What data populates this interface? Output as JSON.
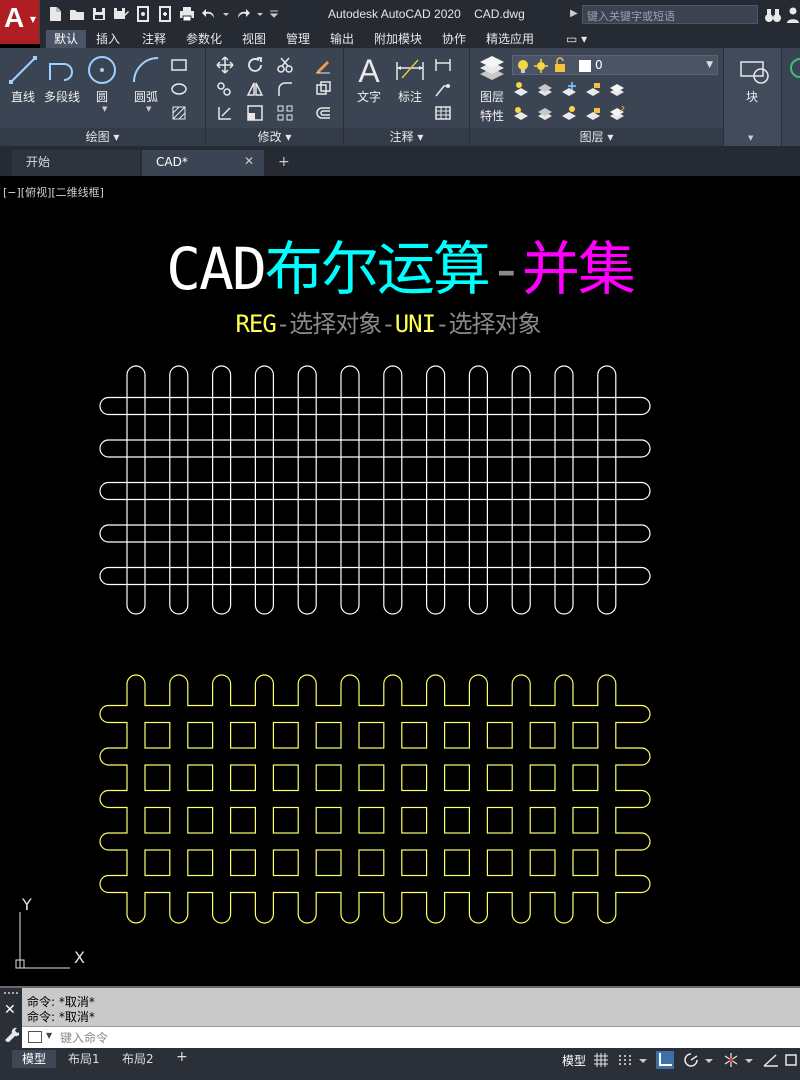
{
  "app": {
    "title": "Autodesk AutoCAD 2020    CAD.dwg",
    "logo_letter": "A",
    "search_placeholder": "键入关键字或短语"
  },
  "ribbon_tabs": [
    "默认",
    "插入",
    "注释",
    "参数化",
    "视图",
    "管理",
    "输出",
    "附加模块",
    "协作",
    "精选应用"
  ],
  "active_tab": "默认",
  "ribbon": {
    "draw_panel": {
      "label": "绘图 ▾",
      "tools": [
        "直线",
        "多段线",
        "圆",
        "圆弧"
      ]
    },
    "modify_panel": {
      "label": "修改 ▾"
    },
    "annotate_panel": {
      "label": "注释 ▾",
      "tools": [
        "文字",
        "标注"
      ]
    },
    "layer_panel": {
      "label": "图层 ▾",
      "properties_label_1": "图层",
      "properties_label_2": "特性",
      "current_layer": "0"
    },
    "block_panel": {
      "label": "块"
    }
  },
  "doc_tabs": [
    "开始",
    "CAD*"
  ],
  "active_doc_tab": "CAD*",
  "viewport_label": "[−][俯视][二维线框]",
  "canvas_text": {
    "title_parts": [
      {
        "text": "CAD",
        "color": "#ffffff"
      },
      {
        "text": "布尔运算",
        "color": "#00ffff"
      },
      {
        "text": "-",
        "color": "#8a8a8a"
      },
      {
        "text": "并集",
        "color": "#ff00ff"
      }
    ],
    "subtitle_parts": [
      {
        "text": "REG",
        "color": "#ffff55"
      },
      {
        "text": "-选择对象-",
        "color": "#8a8a8a"
      },
      {
        "text": "UNI",
        "color": "#ffff55"
      },
      {
        "text": "-选择对象",
        "color": "#8a8a8a"
      }
    ]
  },
  "drawing": {
    "vertical_slot_count": 12,
    "horizontal_slot_count": 5,
    "grid_before_color": "#ffffff",
    "grid_union_color": "#ffff66"
  },
  "ucs": {
    "x_label": "X",
    "y_label": "Y"
  },
  "command_history": [
    "命令: *取消*",
    "命令: *取消*"
  ],
  "command_input_placeholder": "键入命令",
  "layout_tabs": [
    "模型",
    "布局1",
    "布局2"
  ],
  "active_layout": "模型",
  "status": {
    "model_label": "模型"
  }
}
